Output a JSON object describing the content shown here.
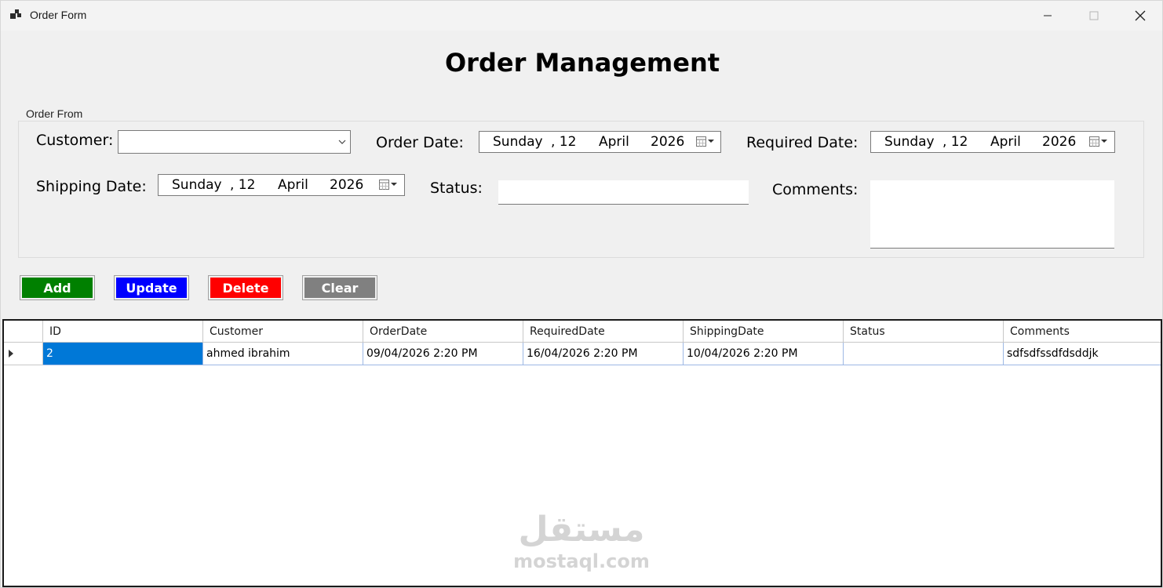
{
  "window": {
    "title": "Order Form"
  },
  "heading": "Order Management",
  "group": {
    "legend": "Order From"
  },
  "form": {
    "customer_label": "Customer:",
    "customer_value": "",
    "order_date_label": "Order Date:",
    "order_date": {
      "day_name": "Sunday",
      "day": ", 12",
      "month": "April",
      "year": "2026"
    },
    "required_date_label": "Required Date:",
    "required_date": {
      "day_name": "Sunday",
      "day": ", 12",
      "month": "April",
      "year": "2026"
    },
    "shipping_date_label": "Shipping Date:",
    "shipping_date": {
      "day_name": "Sunday",
      "day": ", 12",
      "month": "April",
      "year": "2026"
    },
    "status_label": "Status:",
    "status_value": "",
    "comments_label": "Comments:",
    "comments_value": ""
  },
  "buttons": {
    "add": {
      "label": "Add",
      "color": "#008000"
    },
    "update": {
      "label": "Update",
      "color": "#0000ff"
    },
    "delete": {
      "label": "Delete",
      "color": "#ff0000"
    },
    "clear": {
      "label": "Clear",
      "color": "#808080"
    }
  },
  "grid": {
    "columns": [
      "ID",
      "Customer",
      "OrderDate",
      "RequiredDate",
      "ShippingDate",
      "Status",
      "Comments"
    ],
    "rows": [
      [
        "2",
        "ahmed ibrahim",
        "09/04/2026 2:20 PM",
        "16/04/2026 2:20 PM",
        "10/04/2026 2:20 PM",
        "",
        "sdfsdfssdfdsddjk"
      ]
    ],
    "selection_color": "#0078d7"
  },
  "watermark": {
    "arabic": "مستقل",
    "latin": "mostaql.com"
  }
}
